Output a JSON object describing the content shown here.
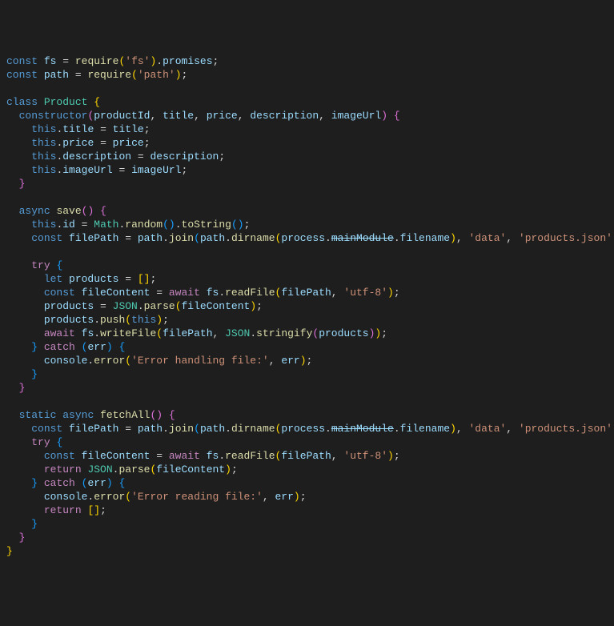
{
  "code": {
    "lines": [
      [
        [
          "kw",
          "const"
        ],
        [
          "pn",
          " "
        ],
        [
          "var",
          "fs"
        ],
        [
          "pn",
          " = "
        ],
        [
          "fn",
          "require"
        ],
        [
          "brk1",
          "("
        ],
        [
          "str",
          "'fs'"
        ],
        [
          "brk1",
          ")"
        ],
        [
          "pn",
          "."
        ],
        [
          "var",
          "promises"
        ],
        [
          "pn",
          ";"
        ]
      ],
      [
        [
          "kw",
          "const"
        ],
        [
          "pn",
          " "
        ],
        [
          "var",
          "path"
        ],
        [
          "pn",
          " = "
        ],
        [
          "fn",
          "require"
        ],
        [
          "brk1",
          "("
        ],
        [
          "str",
          "'path'"
        ],
        [
          "brk1",
          ")"
        ],
        [
          "pn",
          ";"
        ]
      ],
      [],
      [
        [
          "kw",
          "class"
        ],
        [
          "pn",
          " "
        ],
        [
          "cls",
          "Product"
        ],
        [
          "pn",
          " "
        ],
        [
          "brk1",
          "{"
        ]
      ],
      [
        [
          "pn",
          "  "
        ],
        [
          "kw",
          "constructor"
        ],
        [
          "brk2",
          "("
        ],
        [
          "var",
          "productId"
        ],
        [
          "pn",
          ", "
        ],
        [
          "var",
          "title"
        ],
        [
          "pn",
          ", "
        ],
        [
          "var",
          "price"
        ],
        [
          "pn",
          ", "
        ],
        [
          "var",
          "description"
        ],
        [
          "pn",
          ", "
        ],
        [
          "var",
          "imageUrl"
        ],
        [
          "brk2",
          ")"
        ],
        [
          "pn",
          " "
        ],
        [
          "brk2",
          "{"
        ]
      ],
      [
        [
          "pn",
          "    "
        ],
        [
          "kw",
          "this"
        ],
        [
          "pn",
          "."
        ],
        [
          "prop",
          "title"
        ],
        [
          "pn",
          " = "
        ],
        [
          "var",
          "title"
        ],
        [
          "pn",
          ";"
        ]
      ],
      [
        [
          "pn",
          "    "
        ],
        [
          "kw",
          "this"
        ],
        [
          "pn",
          "."
        ],
        [
          "prop",
          "price"
        ],
        [
          "pn",
          " = "
        ],
        [
          "var",
          "price"
        ],
        [
          "pn",
          ";"
        ]
      ],
      [
        [
          "pn",
          "    "
        ],
        [
          "kw",
          "this"
        ],
        [
          "pn",
          "."
        ],
        [
          "prop",
          "description"
        ],
        [
          "pn",
          " = "
        ],
        [
          "var",
          "description"
        ],
        [
          "pn",
          ";"
        ]
      ],
      [
        [
          "pn",
          "    "
        ],
        [
          "kw",
          "this"
        ],
        [
          "pn",
          "."
        ],
        [
          "prop",
          "imageUrl"
        ],
        [
          "pn",
          " = "
        ],
        [
          "var",
          "imageUrl"
        ],
        [
          "pn",
          ";"
        ]
      ],
      [
        [
          "pn",
          "  "
        ],
        [
          "brk2",
          "}"
        ]
      ],
      [],
      [
        [
          "pn",
          "  "
        ],
        [
          "kw",
          "async"
        ],
        [
          "pn",
          " "
        ],
        [
          "fn",
          "save"
        ],
        [
          "brk2",
          "("
        ],
        [
          "brk2",
          ")"
        ],
        [
          "pn",
          " "
        ],
        [
          "brk2",
          "{"
        ]
      ],
      [
        [
          "pn",
          "    "
        ],
        [
          "kw",
          "this"
        ],
        [
          "pn",
          "."
        ],
        [
          "prop",
          "id"
        ],
        [
          "pn",
          " = "
        ],
        [
          "cls",
          "Math"
        ],
        [
          "pn",
          "."
        ],
        [
          "fn",
          "random"
        ],
        [
          "brk3",
          "("
        ],
        [
          "brk3",
          ")"
        ],
        [
          "pn",
          "."
        ],
        [
          "fn",
          "toString"
        ],
        [
          "brk3",
          "("
        ],
        [
          "brk3",
          ")"
        ],
        [
          "pn",
          ";"
        ]
      ],
      [
        [
          "pn",
          "    "
        ],
        [
          "kw",
          "const"
        ],
        [
          "pn",
          " "
        ],
        [
          "var",
          "filePath"
        ],
        [
          "pn",
          " = "
        ],
        [
          "var",
          "path"
        ],
        [
          "pn",
          "."
        ],
        [
          "fn",
          "join"
        ],
        [
          "brk3",
          "("
        ],
        [
          "var",
          "path"
        ],
        [
          "pn",
          "."
        ],
        [
          "fn",
          "dirname"
        ],
        [
          "brk1",
          "("
        ],
        [
          "var",
          "process"
        ],
        [
          "pn",
          "."
        ],
        [
          "prop depr",
          "mainModule"
        ],
        [
          "pn",
          "."
        ],
        [
          "prop",
          "filename"
        ],
        [
          "brk1",
          ")"
        ],
        [
          "pn",
          ", "
        ],
        [
          "str",
          "'data'"
        ],
        [
          "pn",
          ", "
        ],
        [
          "str",
          "'products.json'"
        ],
        [
          "brk3",
          ")"
        ],
        [
          "pn",
          ";"
        ]
      ],
      [],
      [
        [
          "pn",
          "    "
        ],
        [
          "ctl",
          "try"
        ],
        [
          "pn",
          " "
        ],
        [
          "brk3",
          "{"
        ]
      ],
      [
        [
          "pn",
          "      "
        ],
        [
          "kw",
          "let"
        ],
        [
          "pn",
          " "
        ],
        [
          "var",
          "products"
        ],
        [
          "pn",
          " = "
        ],
        [
          "brk1",
          "["
        ],
        [
          "brk1",
          "]"
        ],
        [
          "pn",
          ";"
        ]
      ],
      [
        [
          "pn",
          "      "
        ],
        [
          "kw",
          "const"
        ],
        [
          "pn",
          " "
        ],
        [
          "var",
          "fileContent"
        ],
        [
          "pn",
          " = "
        ],
        [
          "ctl",
          "await"
        ],
        [
          "pn",
          " "
        ],
        [
          "var",
          "fs"
        ],
        [
          "pn",
          "."
        ],
        [
          "fn",
          "readFile"
        ],
        [
          "brk1",
          "("
        ],
        [
          "var",
          "filePath"
        ],
        [
          "pn",
          ", "
        ],
        [
          "str",
          "'utf-8'"
        ],
        [
          "brk1",
          ")"
        ],
        [
          "pn",
          ";"
        ]
      ],
      [
        [
          "pn",
          "      "
        ],
        [
          "var",
          "products"
        ],
        [
          "pn",
          " = "
        ],
        [
          "cls",
          "JSON"
        ],
        [
          "pn",
          "."
        ],
        [
          "fn",
          "parse"
        ],
        [
          "brk1",
          "("
        ],
        [
          "var",
          "fileContent"
        ],
        [
          "brk1",
          ")"
        ],
        [
          "pn",
          ";"
        ]
      ],
      [
        [
          "pn",
          "      "
        ],
        [
          "var",
          "products"
        ],
        [
          "pn",
          "."
        ],
        [
          "fn",
          "push"
        ],
        [
          "brk1",
          "("
        ],
        [
          "kw",
          "this"
        ],
        [
          "brk1",
          ")"
        ],
        [
          "pn",
          ";"
        ]
      ],
      [
        [
          "pn",
          "      "
        ],
        [
          "ctl",
          "await"
        ],
        [
          "pn",
          " "
        ],
        [
          "var",
          "fs"
        ],
        [
          "pn",
          "."
        ],
        [
          "fn",
          "writeFile"
        ],
        [
          "brk1",
          "("
        ],
        [
          "var",
          "filePath"
        ],
        [
          "pn",
          ", "
        ],
        [
          "cls",
          "JSON"
        ],
        [
          "pn",
          "."
        ],
        [
          "fn",
          "stringify"
        ],
        [
          "brk2",
          "("
        ],
        [
          "var",
          "products"
        ],
        [
          "brk2",
          ")"
        ],
        [
          "brk1",
          ")"
        ],
        [
          "pn",
          ";"
        ]
      ],
      [
        [
          "pn",
          "    "
        ],
        [
          "brk3",
          "}"
        ],
        [
          "pn",
          " "
        ],
        [
          "ctl",
          "catch"
        ],
        [
          "pn",
          " "
        ],
        [
          "brk3",
          "("
        ],
        [
          "var",
          "err"
        ],
        [
          "brk3",
          ")"
        ],
        [
          "pn",
          " "
        ],
        [
          "brk3",
          "{"
        ]
      ],
      [
        [
          "pn",
          "      "
        ],
        [
          "var",
          "console"
        ],
        [
          "pn",
          "."
        ],
        [
          "fn",
          "error"
        ],
        [
          "brk1",
          "("
        ],
        [
          "str",
          "'Error handling file:'"
        ],
        [
          "pn",
          ", "
        ],
        [
          "var",
          "err"
        ],
        [
          "brk1",
          ")"
        ],
        [
          "pn",
          ";"
        ]
      ],
      [
        [
          "pn",
          "    "
        ],
        [
          "brk3",
          "}"
        ]
      ],
      [
        [
          "pn",
          "  "
        ],
        [
          "brk2",
          "}"
        ]
      ],
      [],
      [
        [
          "pn",
          "  "
        ],
        [
          "kw",
          "static"
        ],
        [
          "pn",
          " "
        ],
        [
          "kw",
          "async"
        ],
        [
          "pn",
          " "
        ],
        [
          "fn",
          "fetchAll"
        ],
        [
          "brk2",
          "("
        ],
        [
          "brk2",
          ")"
        ],
        [
          "pn",
          " "
        ],
        [
          "brk2",
          "{"
        ]
      ],
      [
        [
          "pn",
          "    "
        ],
        [
          "kw",
          "const"
        ],
        [
          "pn",
          " "
        ],
        [
          "var",
          "filePath"
        ],
        [
          "pn",
          " = "
        ],
        [
          "var",
          "path"
        ],
        [
          "pn",
          "."
        ],
        [
          "fn",
          "join"
        ],
        [
          "brk3",
          "("
        ],
        [
          "var",
          "path"
        ],
        [
          "pn",
          "."
        ],
        [
          "fn",
          "dirname"
        ],
        [
          "brk1",
          "("
        ],
        [
          "var",
          "process"
        ],
        [
          "pn",
          "."
        ],
        [
          "prop depr",
          "mainModule"
        ],
        [
          "pn",
          "."
        ],
        [
          "prop",
          "filename"
        ],
        [
          "brk1",
          ")"
        ],
        [
          "pn",
          ", "
        ],
        [
          "str",
          "'data'"
        ],
        [
          "pn",
          ", "
        ],
        [
          "str",
          "'products.json'"
        ],
        [
          "brk3",
          ")"
        ],
        [
          "pn",
          ";"
        ]
      ],
      [
        [
          "pn",
          "    "
        ],
        [
          "ctl",
          "try"
        ],
        [
          "pn",
          " "
        ],
        [
          "brk3",
          "{"
        ]
      ],
      [
        [
          "pn",
          "      "
        ],
        [
          "kw",
          "const"
        ],
        [
          "pn",
          " "
        ],
        [
          "var",
          "fileContent"
        ],
        [
          "pn",
          " = "
        ],
        [
          "ctl",
          "await"
        ],
        [
          "pn",
          " "
        ],
        [
          "var",
          "fs"
        ],
        [
          "pn",
          "."
        ],
        [
          "fn",
          "readFile"
        ],
        [
          "brk1",
          "("
        ],
        [
          "var",
          "filePath"
        ],
        [
          "pn",
          ", "
        ],
        [
          "str",
          "'utf-8'"
        ],
        [
          "brk1",
          ")"
        ],
        [
          "pn",
          ";"
        ]
      ],
      [
        [
          "pn",
          "      "
        ],
        [
          "ctl",
          "return"
        ],
        [
          "pn",
          " "
        ],
        [
          "cls",
          "JSON"
        ],
        [
          "pn",
          "."
        ],
        [
          "fn",
          "parse"
        ],
        [
          "brk1",
          "("
        ],
        [
          "var",
          "fileContent"
        ],
        [
          "brk1",
          ")"
        ],
        [
          "pn",
          ";"
        ]
      ],
      [
        [
          "pn",
          "    "
        ],
        [
          "brk3",
          "}"
        ],
        [
          "pn",
          " "
        ],
        [
          "ctl",
          "catch"
        ],
        [
          "pn",
          " "
        ],
        [
          "brk3",
          "("
        ],
        [
          "var",
          "err"
        ],
        [
          "brk3",
          ")"
        ],
        [
          "pn",
          " "
        ],
        [
          "brk3",
          "{"
        ]
      ],
      [
        [
          "pn",
          "      "
        ],
        [
          "var",
          "console"
        ],
        [
          "pn",
          "."
        ],
        [
          "fn",
          "error"
        ],
        [
          "brk1",
          "("
        ],
        [
          "str",
          "'Error reading file:'"
        ],
        [
          "pn",
          ", "
        ],
        [
          "var",
          "err"
        ],
        [
          "brk1",
          ")"
        ],
        [
          "pn",
          ";"
        ]
      ],
      [
        [
          "pn",
          "      "
        ],
        [
          "ctl",
          "return"
        ],
        [
          "pn",
          " "
        ],
        [
          "brk1",
          "["
        ],
        [
          "brk1",
          "]"
        ],
        [
          "pn",
          ";"
        ]
      ],
      [
        [
          "pn",
          "    "
        ],
        [
          "brk3",
          "}"
        ]
      ],
      [
        [
          "pn",
          "  "
        ],
        [
          "brk2",
          "}"
        ]
      ],
      [
        [
          "brk1",
          "}"
        ]
      ]
    ]
  }
}
